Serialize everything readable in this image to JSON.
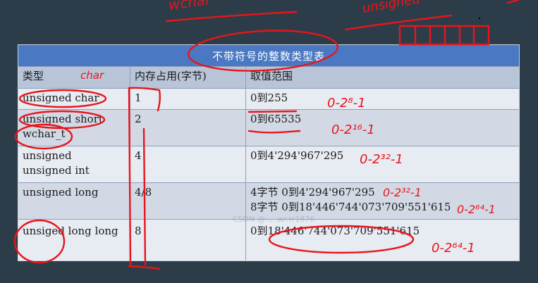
{
  "table": {
    "title": "不带符号的整数类型表",
    "headers": [
      "类型",
      "内存占用(字节)",
      "取值范围"
    ],
    "rows": [
      {
        "type": [
          "unsigned char"
        ],
        "size": "1",
        "range": [
          "0到255"
        ]
      },
      {
        "type": [
          "unsigned short",
          "wchar_t"
        ],
        "size": "2",
        "range": [
          "0到65535"
        ]
      },
      {
        "type": [
          "unsigned",
          "unsigned int"
        ],
        "size": "4",
        "range": [
          "0到4'294'967'295"
        ]
      },
      {
        "type": [
          "unsigned long"
        ],
        "size": "4/8",
        "range": [
          "4字节 0到4'294'967'295",
          "8字节 0到18'446'744'073'709'551'615"
        ]
      },
      {
        "type": [
          "unsiged long long"
        ],
        "size": "8",
        "range": [
          "0到18'446'744'073'709'551'615"
        ]
      }
    ]
  },
  "watermark": "CSDN @... .wr.rr1876",
  "annotations": {
    "top_left": "wchar",
    "top_right": "unsigned",
    "header_note": "char",
    "row1_range": "0-2⁸-1",
    "row2_range": "0-2¹⁶-1",
    "row3_range": "0-2³²-1",
    "row4_range_a": "0-2³²-1",
    "row4_range_b": "0-2⁶⁴-1",
    "row5_range": "0-2⁶⁴-1"
  },
  "colors": {
    "background": "#2c3d49",
    "title_bar": "#4a78c2",
    "header_row": "#b8c4d8",
    "ink": "#e8151b"
  }
}
